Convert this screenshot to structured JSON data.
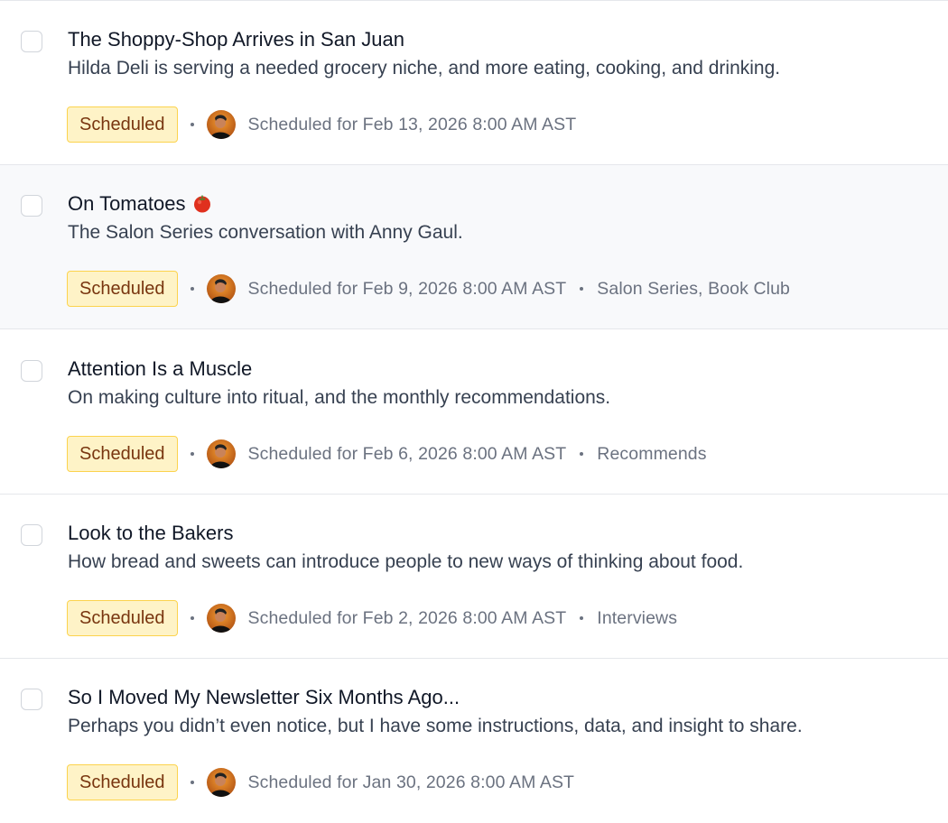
{
  "posts": [
    {
      "title": "The Shoppy-Shop Arrives in San Juan",
      "subtitle": "Hilda Deli is serving a needed grocery niche, and more eating, cooking, and drinking.",
      "status": "Scheduled",
      "schedule": "Scheduled for Feb 13, 2026 8:00 AM AST",
      "tags": ""
    },
    {
      "title": "On Tomatoes",
      "title_icon": "tomato-emoji",
      "subtitle": "The Salon Series conversation with Anny Gaul.",
      "status": "Scheduled",
      "schedule": "Scheduled for Feb 9, 2026 8:00 AM AST",
      "tags": "Salon Series, Book Club"
    },
    {
      "title": "Attention Is a Muscle",
      "subtitle": "On making culture into ritual, and the monthly recommendations.",
      "status": "Scheduled",
      "schedule": "Scheduled for Feb 6, 2026 8:00 AM AST",
      "tags": "Recommends"
    },
    {
      "title": "Look to the Bakers",
      "subtitle": "How bread and sweets can introduce people to new ways of thinking about food.",
      "status": "Scheduled",
      "schedule": "Scheduled for Feb 2, 2026 8:00 AM AST",
      "tags": "Interviews"
    },
    {
      "title": "So I Moved My Newsletter Six Months Ago...",
      "subtitle": "Perhaps you didn’t even notice, but I have some instructions, data, and insight to share.",
      "status": "Scheduled",
      "schedule": "Scheduled for Jan 30, 2026 8:00 AM AST",
      "tags": ""
    }
  ],
  "colors": {
    "badge_bg": "#fef3c7",
    "badge_border": "#fcd34d",
    "badge_text": "#78350f",
    "hover_row": "#f8f9fb"
  }
}
